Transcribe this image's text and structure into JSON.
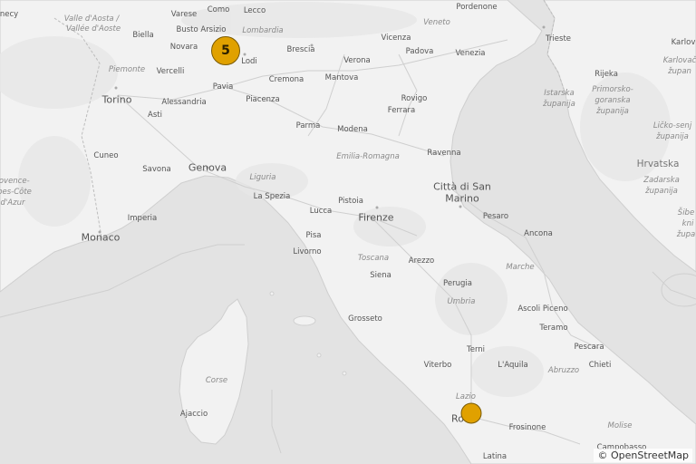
{
  "attribution": "© OpenStreetMap",
  "colors": {
    "marker": "#e0a100",
    "marker_border": "#7a5a00",
    "land": "#f2f2f2",
    "sea": "#e3e3e3"
  },
  "markers": [
    {
      "name": "cluster-marker-lombardia",
      "count": "5"
    },
    {
      "name": "marker-roma",
      "count": ""
    }
  ],
  "labels": {
    "como": "Como",
    "lecco": "Lecco",
    "varese": "Varese",
    "valle_aosta": "Valle d'Aosta /",
    "vallee_aoste": "Vallée d'Aoste",
    "biella": "Biella",
    "busto": "Busto Arsizio",
    "lombardia": "Lombardia",
    "novara": "Novara",
    "lodi": "Lodi",
    "piemonte": "Piemonte",
    "vercelli": "Vercelli",
    "pavia": "Pavia",
    "torino": "Torino",
    "alessandria": "Alessandria",
    "asti": "Asti",
    "piacenza": "Piacenza",
    "cremona": "Cremona",
    "mantova": "Mantova",
    "brescia": "Brescia",
    "verona": "Verona",
    "vicenza": "Vicenza",
    "padova": "Padova",
    "venezia": "Venezia",
    "veneto": "Veneto",
    "pordenone": "Pordenone",
    "trieste": "Trieste",
    "rovigo": "Rovigo",
    "ferrara": "Ferrara",
    "parma": "Parma",
    "modena": "Modena",
    "emilia": "Emilia-Romagna",
    "ravenna": "Ravenna",
    "cuneo": "Cuneo",
    "savona": "Savona",
    "genova": "Genova",
    "liguria": "Liguria",
    "la_spezia": "La Spezia",
    "imperia": "Imperia",
    "monaco": "Monaco",
    "provence1": "rovence-",
    "provence2": "pes-Côte",
    "provence3": "d'Azur",
    "necy": "necy",
    "pistoia": "Pistoia",
    "lucca": "Lucca",
    "firenze": "Firenze",
    "pisa": "Pisa",
    "livorno": "Livorno",
    "toscana": "Toscana",
    "arezzo": "Arezzo",
    "siena": "Siena",
    "citta": "Città di San",
    "marino": "Marino",
    "pesaro": "Pesaro",
    "ancona": "Ancona",
    "marche": "Marche",
    "perugia": "Perugia",
    "umbria": "Umbria",
    "grosseto": "Grosseto",
    "ascoli": "Ascoli Piceno",
    "teramo": "Teramo",
    "terni": "Terni",
    "pescara": "Pescara",
    "laquila": "L'Aquila",
    "chieti": "Chieti",
    "abruzzo": "Abruzzo",
    "viterbo": "Viterbo",
    "lazio": "Lazio",
    "roma": "Ro",
    "frosinone": "Frosinone",
    "molise": "Molise",
    "latina": "Latina",
    "campobasso": "Campobasso",
    "corse": "Corse",
    "ajaccio": "Ajaccio",
    "rijeka": "Rijeka",
    "primorsko1": "Primorsko-",
    "primorsko2": "goranska",
    "primorsko3": "županija",
    "istarska1": "Istarska",
    "istarska2": "županija",
    "karlovac": "Karlov",
    "karlovacka1": "Karlovač",
    "karlovacka2": "župan",
    "licko1": "Ličko-senj",
    "licko2": "županija",
    "hrvatska": "Hrvatska",
    "zadarska1": "Zadarska",
    "zadarska2": "županija",
    "sibenik1": "Šibe",
    "sibenik2": "kni",
    "sibenik3": "župa"
  }
}
